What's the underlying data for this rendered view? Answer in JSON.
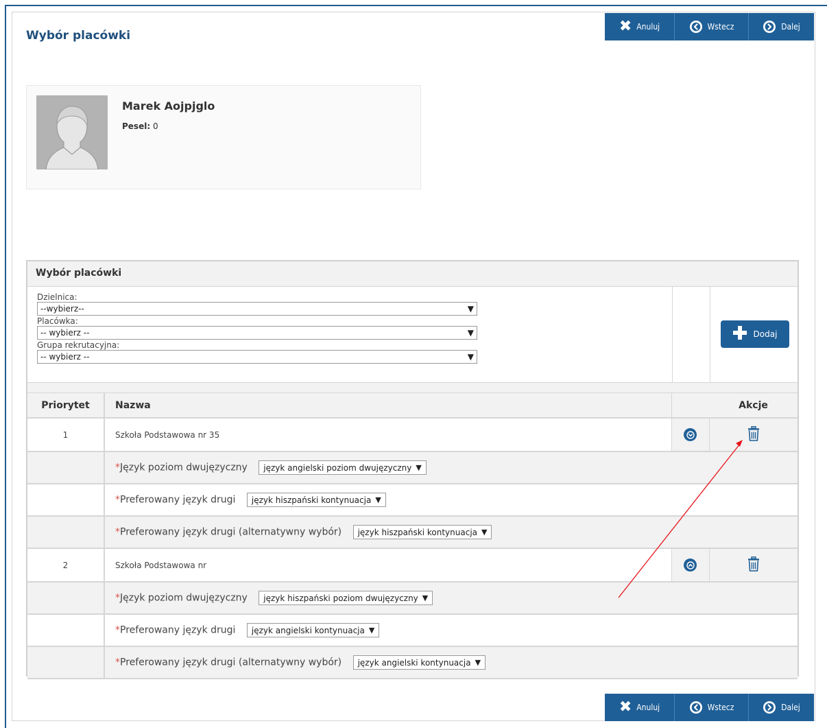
{
  "nav": {
    "cancel_label": "Anuluj",
    "back_label": "Wstecz",
    "next_label": "Dalej"
  },
  "page_title": "Wybór placówki",
  "profile": {
    "name": "Marek Aojpjglo",
    "pesel_label": "Pesel:",
    "pesel_value": "0"
  },
  "selection": {
    "title": "Wybór placówki",
    "district_label": "Dzielnica:",
    "district_value": "--wybierz--",
    "facility_label": "Placówka:",
    "facility_value": "-- wybierz --",
    "group_label": "Grupa rekrutacyjna:",
    "group_value": "-- wybierz --",
    "add_label": "Dodaj"
  },
  "table": {
    "headers": {
      "priority": "Priorytet",
      "name": "Nazwa",
      "actions": "Akcje"
    },
    "rows": [
      {
        "priority": "1",
        "name": "Szkoła Podstawowa nr 35",
        "move_icon": "chevron-down-circle-icon",
        "options": [
          {
            "label": "Język poziom dwujęzyczny",
            "value": "język angielski poziom dwujęzyczny"
          },
          {
            "label": "Preferowany język drugi",
            "value": "język hiszpański kontynuacja"
          },
          {
            "label": "Preferowany język drugi (alternatywny wybór)",
            "value": "język hiszpański kontynuacja"
          }
        ]
      },
      {
        "priority": "2",
        "name": "Szkoła Podstawowa nr",
        "move_icon": "chevron-up-circle-icon",
        "options": [
          {
            "label": "Język poziom dwujęzyczny",
            "value": "język hiszpański poziom dwujęzyczny"
          },
          {
            "label": "Preferowany język drugi",
            "value": "język angielski kontynuacja"
          },
          {
            "label": "Preferowany język drugi (alternatywny wybór)",
            "value": "język angielski kontynuacja"
          }
        ]
      }
    ]
  },
  "required_mark": "*",
  "dropdown_arrow": "▼",
  "colors": {
    "primary": "#1f5f97",
    "title": "#1f4f7c",
    "required": "#d9534f",
    "annotation_arrow": "#e8141b"
  }
}
